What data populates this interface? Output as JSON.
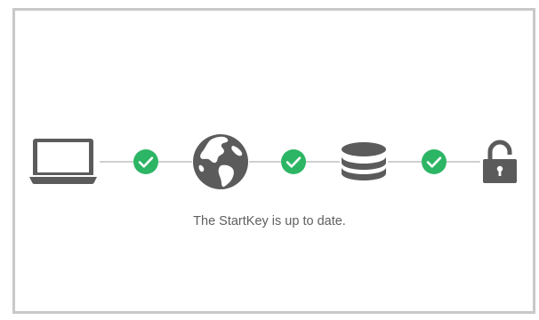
{
  "status": {
    "message": "The StartKey is up to date."
  },
  "pipeline": {
    "steps": [
      {
        "icon": "laptop-icon"
      },
      {
        "icon": "globe-icon"
      },
      {
        "icon": "database-icon"
      },
      {
        "icon": "lock-icon"
      }
    ],
    "checks": [
      {
        "icon": "check-circle-icon",
        "state": "ok"
      },
      {
        "icon": "check-circle-icon",
        "state": "ok"
      },
      {
        "icon": "check-circle-icon",
        "state": "ok"
      }
    ]
  },
  "colors": {
    "icon": "#5b5b5b",
    "check": "#2cb564",
    "connector": "#cfcfcf",
    "border": "#c8c8c8",
    "text": "#5f5f5f"
  }
}
